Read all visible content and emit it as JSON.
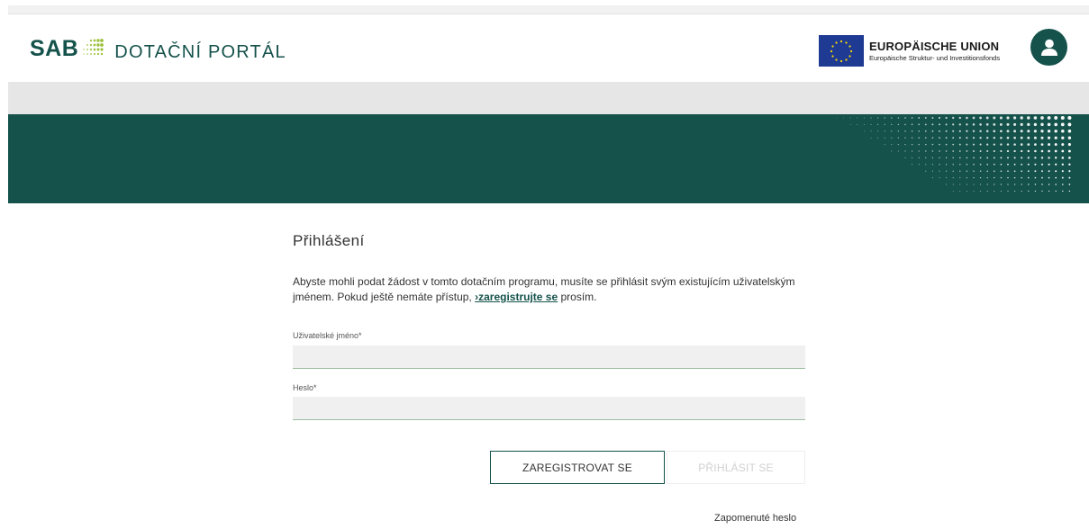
{
  "header": {
    "logo_primary": "SAB",
    "logo_secondary": "DOTAČNÍ PORTÁL",
    "eu_title": "EUROPÄISCHE UNION",
    "eu_subtitle": "Europäische Struktur- und Investitionsfonds"
  },
  "colors": {
    "brand": "#15524b",
    "accent": "#9bc23c",
    "eu_blue": "#1f3a93",
    "eu_star": "#ffdd00"
  },
  "icons": {
    "avatar": "user-icon"
  },
  "login": {
    "title": "Přihlášení",
    "intro_before": "Abyste mohli podat žádost v tomto dotačním programu, musíte se přihlásit svým existujícím uživatelským jménem. Pokud ještě nemáte přístup, ",
    "register_link": "›zaregistrujte se",
    "intro_after": " prosím.",
    "username_label": "Uživatelské jméno*",
    "username_value": "",
    "password_label": "Heslo*",
    "password_value": "",
    "register_button": "ZAREGISTROVAT SE",
    "login_button": "PŘIHLÁSIT SE",
    "forgot_password": "Zapomenuté heslo"
  }
}
